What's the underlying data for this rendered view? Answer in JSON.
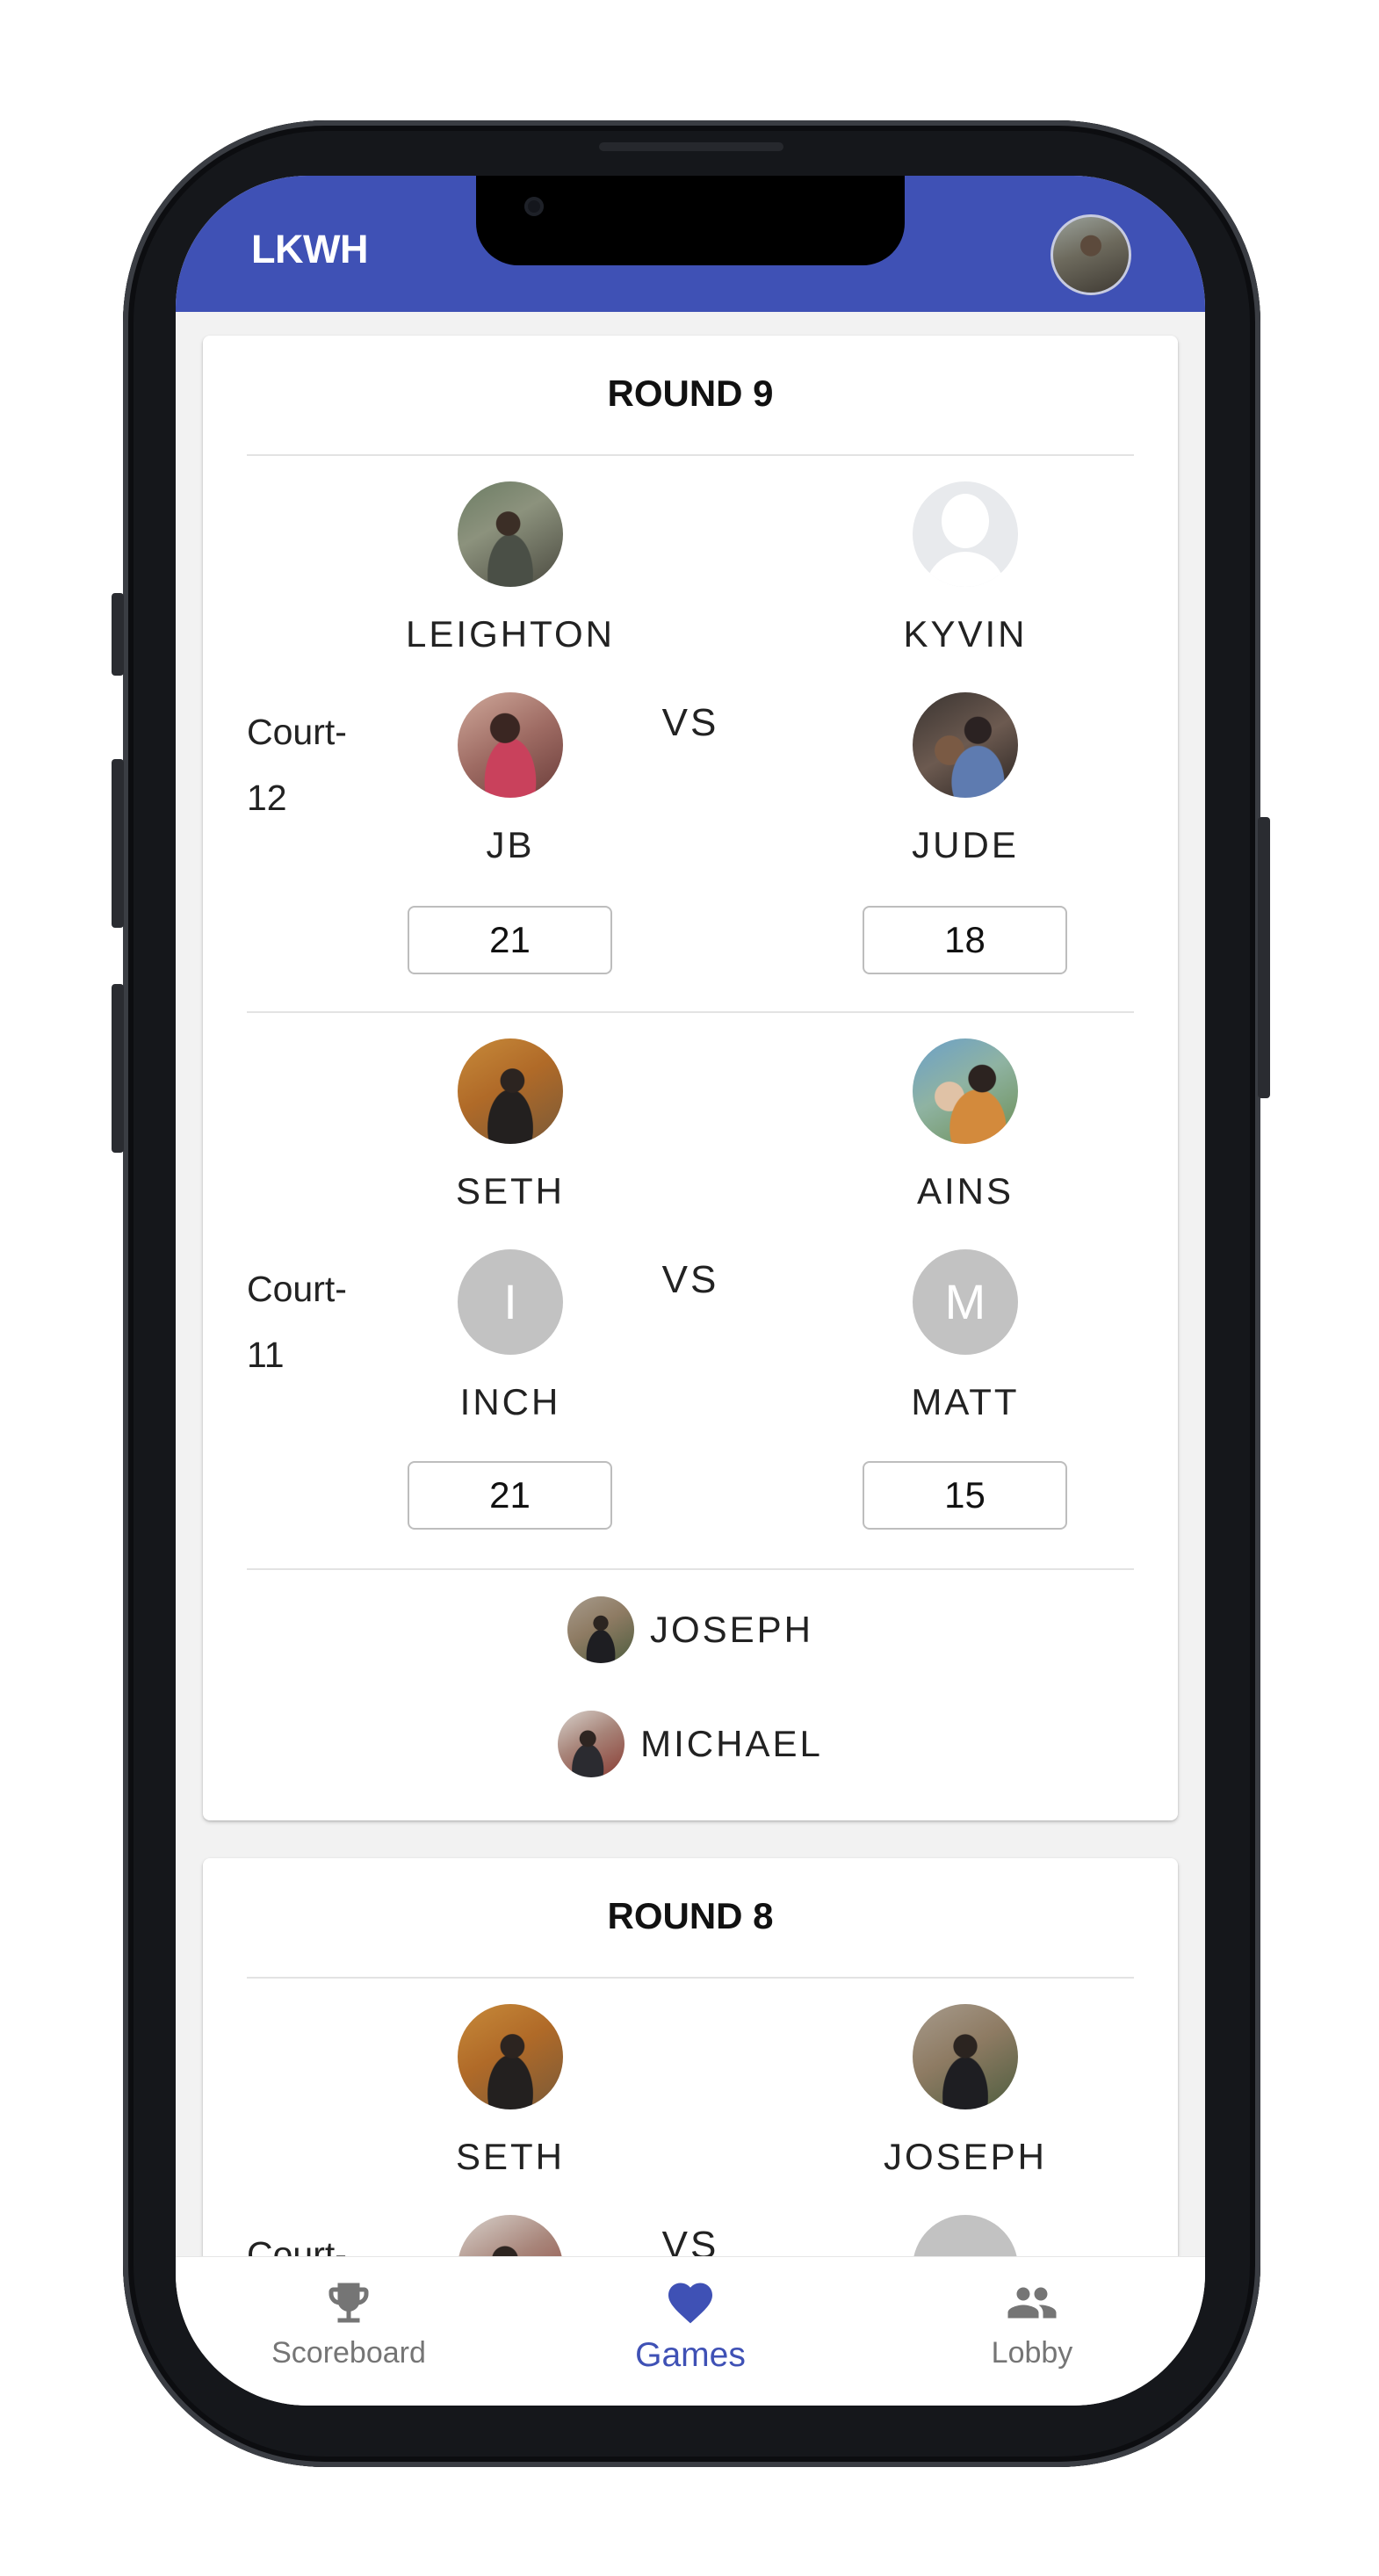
{
  "app_bar": {
    "title": "LKWH"
  },
  "rounds": [
    {
      "title": "ROUND 9",
      "matches": [
        {
          "court": "Court-12",
          "vs": "VS",
          "team1": {
            "players": [
              {
                "name": "LEIGHTON",
                "avatar": "photo"
              },
              {
                "name": "JB",
                "avatar": "photo"
              }
            ],
            "score": "21"
          },
          "team2": {
            "players": [
              {
                "name": "KYVIN",
                "avatar": "blank"
              },
              {
                "name": "JUDE",
                "avatar": "photo"
              }
            ],
            "score": "18"
          }
        },
        {
          "court": "Court-11",
          "vs": "VS",
          "team1": {
            "players": [
              {
                "name": "SETH",
                "avatar": "photo"
              },
              {
                "name": "INCH",
                "avatar": "letter",
                "initial": "I"
              }
            ],
            "score": "21"
          },
          "team2": {
            "players": [
              {
                "name": "AINS",
                "avatar": "photo"
              },
              {
                "name": "MATT",
                "avatar": "letter",
                "initial": "M"
              }
            ],
            "score": "15"
          }
        }
      ],
      "sitting_out": [
        {
          "name": "JOSEPH"
        },
        {
          "name": "MICHAEL"
        }
      ]
    },
    {
      "title": "ROUND 8",
      "matches": [
        {
          "court": "Court-",
          "vs": "VS",
          "team1": {
            "players": [
              {
                "name": "SETH",
                "avatar": "photo"
              }
            ]
          },
          "team2": {
            "players": [
              {
                "name": "JOSEPH",
                "avatar": "photo"
              }
            ]
          }
        }
      ]
    }
  ],
  "bottom_nav": {
    "items": [
      {
        "label": "Scoreboard",
        "icon": "trophy-icon",
        "active": false
      },
      {
        "label": "Games",
        "icon": "heart-icon",
        "active": true
      },
      {
        "label": "Lobby",
        "icon": "people-icon",
        "active": false
      }
    ]
  },
  "colors": {
    "primary": "#3f51b5",
    "inactive": "#757575",
    "avatar_letter_bg": "#c2c2c2"
  }
}
